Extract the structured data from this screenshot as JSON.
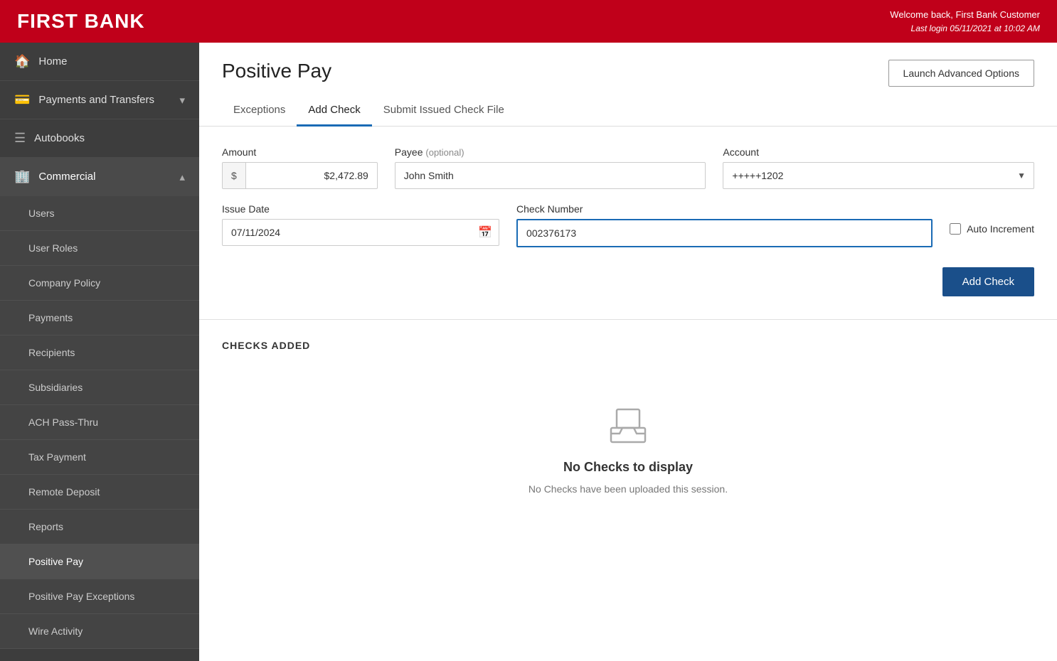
{
  "header": {
    "brand": "FIRST BANK",
    "welcome": "Welcome back, First Bank Customer",
    "last_login": "Last login 05/11/2021 at 10:02 AM"
  },
  "sidebar": {
    "items": [
      {
        "id": "home",
        "label": "Home",
        "icon": "🏠",
        "sub": false
      },
      {
        "id": "payments-transfers",
        "label": "Payments and Transfers",
        "icon": "💳",
        "sub": false,
        "hasChevron": true
      },
      {
        "id": "autobooks",
        "label": "Autobooks",
        "icon": "☰",
        "sub": false
      },
      {
        "id": "commercial",
        "label": "Commercial",
        "icon": "🏢",
        "sub": false,
        "hasChevron": true,
        "expanded": true
      },
      {
        "id": "users",
        "label": "Users",
        "sub": true
      },
      {
        "id": "user-roles",
        "label": "User Roles",
        "sub": true
      },
      {
        "id": "company-policy",
        "label": "Company Policy",
        "sub": true
      },
      {
        "id": "payments",
        "label": "Payments",
        "sub": true
      },
      {
        "id": "recipients",
        "label": "Recipients",
        "sub": true
      },
      {
        "id": "subsidiaries",
        "label": "Subsidiaries",
        "sub": true
      },
      {
        "id": "ach-pass-thru",
        "label": "ACH Pass-Thru",
        "sub": true
      },
      {
        "id": "tax-payment",
        "label": "Tax Payment",
        "sub": true
      },
      {
        "id": "remote-deposit",
        "label": "Remote Deposit",
        "sub": true
      },
      {
        "id": "reports",
        "label": "Reports",
        "sub": true
      },
      {
        "id": "positive-pay",
        "label": "Positive Pay",
        "sub": true,
        "active": true
      },
      {
        "id": "positive-pay-exceptions",
        "label": "Positive Pay Exceptions",
        "sub": true
      },
      {
        "id": "wire-activity",
        "label": "Wire Activity",
        "sub": true
      }
    ]
  },
  "page": {
    "title": "Positive Pay",
    "launch_btn": "Launch Advanced Options"
  },
  "tabs": [
    {
      "id": "exceptions",
      "label": "Exceptions",
      "active": false
    },
    {
      "id": "add-check",
      "label": "Add Check",
      "active": true
    },
    {
      "id": "submit-issued-check-file",
      "label": "Submit Issued Check File",
      "active": false
    }
  ],
  "form": {
    "amount_label": "Amount",
    "amount_prefix": "$",
    "amount_value": "$2,472.89",
    "payee_label": "Payee",
    "payee_optional": "(optional)",
    "payee_value": "John Smith",
    "account_label": "Account",
    "account_value": "+++++1202",
    "issue_date_label": "Issue Date",
    "issue_date_value": "07/11/2024",
    "check_number_label": "Check Number",
    "check_number_value": "002376173",
    "auto_increment_label": "Auto Increment",
    "add_check_btn": "Add Check"
  },
  "checks_section": {
    "title": "CHECKS ADDED",
    "empty_title": "No Checks to display",
    "empty_subtitle": "No Checks have been uploaded this session."
  }
}
